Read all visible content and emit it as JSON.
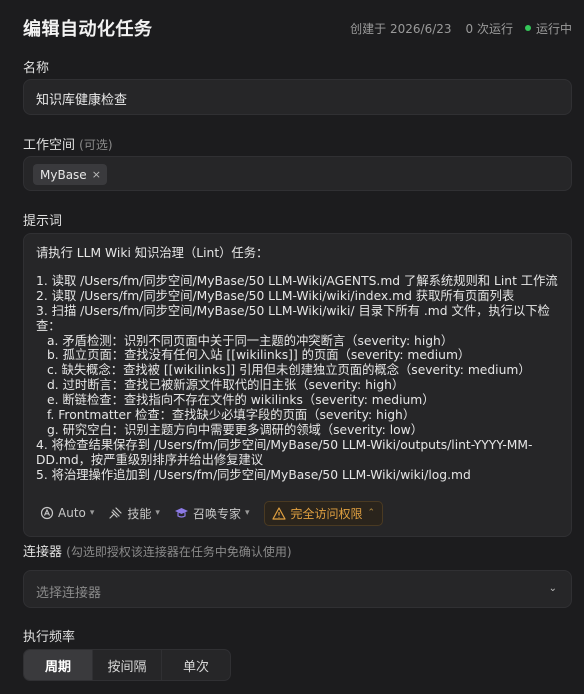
{
  "header": {
    "title": "编辑自动化任务",
    "created": "创建于 2026/6/23",
    "runs": "0 次运行",
    "status": "运行中",
    "status_color": "#34c759"
  },
  "name_field": {
    "label": "名称",
    "value": "知识库健康检查"
  },
  "workspace": {
    "label": "工作空间",
    "optional": "(可选)",
    "chip": "MyBase",
    "chip_remove": "×"
  },
  "prompt": {
    "label": "提示词",
    "lines": [
      "请执行 LLM Wiki 知识治理（Lint）任务：",
      "",
      "1. 读取 /Users/fm/同步空间/MyBase/50 LLM-Wiki/AGENTS.md 了解系统规则和 Lint 工作流",
      "2. 读取 /Users/fm/同步空间/MyBase/50 LLM-Wiki/wiki/index.md 获取所有页面列表",
      "3. 扫描 /Users/fm/同步空间/MyBase/50 LLM-Wiki/wiki/ 目录下所有 .md 文件，执行以下检查：",
      "a. 矛盾检测：识别不同页面中关于同一主题的冲突断言（severity: high）",
      "b. 孤立页面：查找没有任何入站 [[wikilinks]] 的页面（severity: medium）",
      "c. 缺失概念：查找被 [[wikilinks]] 引用但未创建独立页面的概念（severity: medium）",
      "d. 过时断言：查找已被新源文件取代的旧主张（severity: high）",
      "e. 断链检查：查找指向不存在文件的 wikilinks（severity: medium）",
      "f. Frontmatter 检查：查找缺少必填字段的页面（severity: high）",
      "g. 研究空白：识别主题方向中需要更多调研的领域（severity: low）",
      "4. 将检查结果保存到 /Users/fm/同步空间/MyBase/50 LLM-Wiki/outputs/lint-YYYY-MM-DD.md，按严重级别排序并给出修复建议",
      "5. 将治理操作追加到 /Users/fm/同步空间/MyBase/50 LLM-Wiki/wiki/log.md"
    ],
    "toolbar": {
      "model": "Auto",
      "skills": "技能",
      "experts": "召唤专家",
      "permission": "完全访问权限",
      "warn_color": "#e0a040"
    }
  },
  "connector": {
    "label": "连接器",
    "hint": "(勾选即授权该连接器在任务中免确认使用)",
    "placeholder": "选择连接器"
  },
  "frequency": {
    "label": "执行频率",
    "options": [
      "周期",
      "按间隔",
      "单次"
    ]
  }
}
